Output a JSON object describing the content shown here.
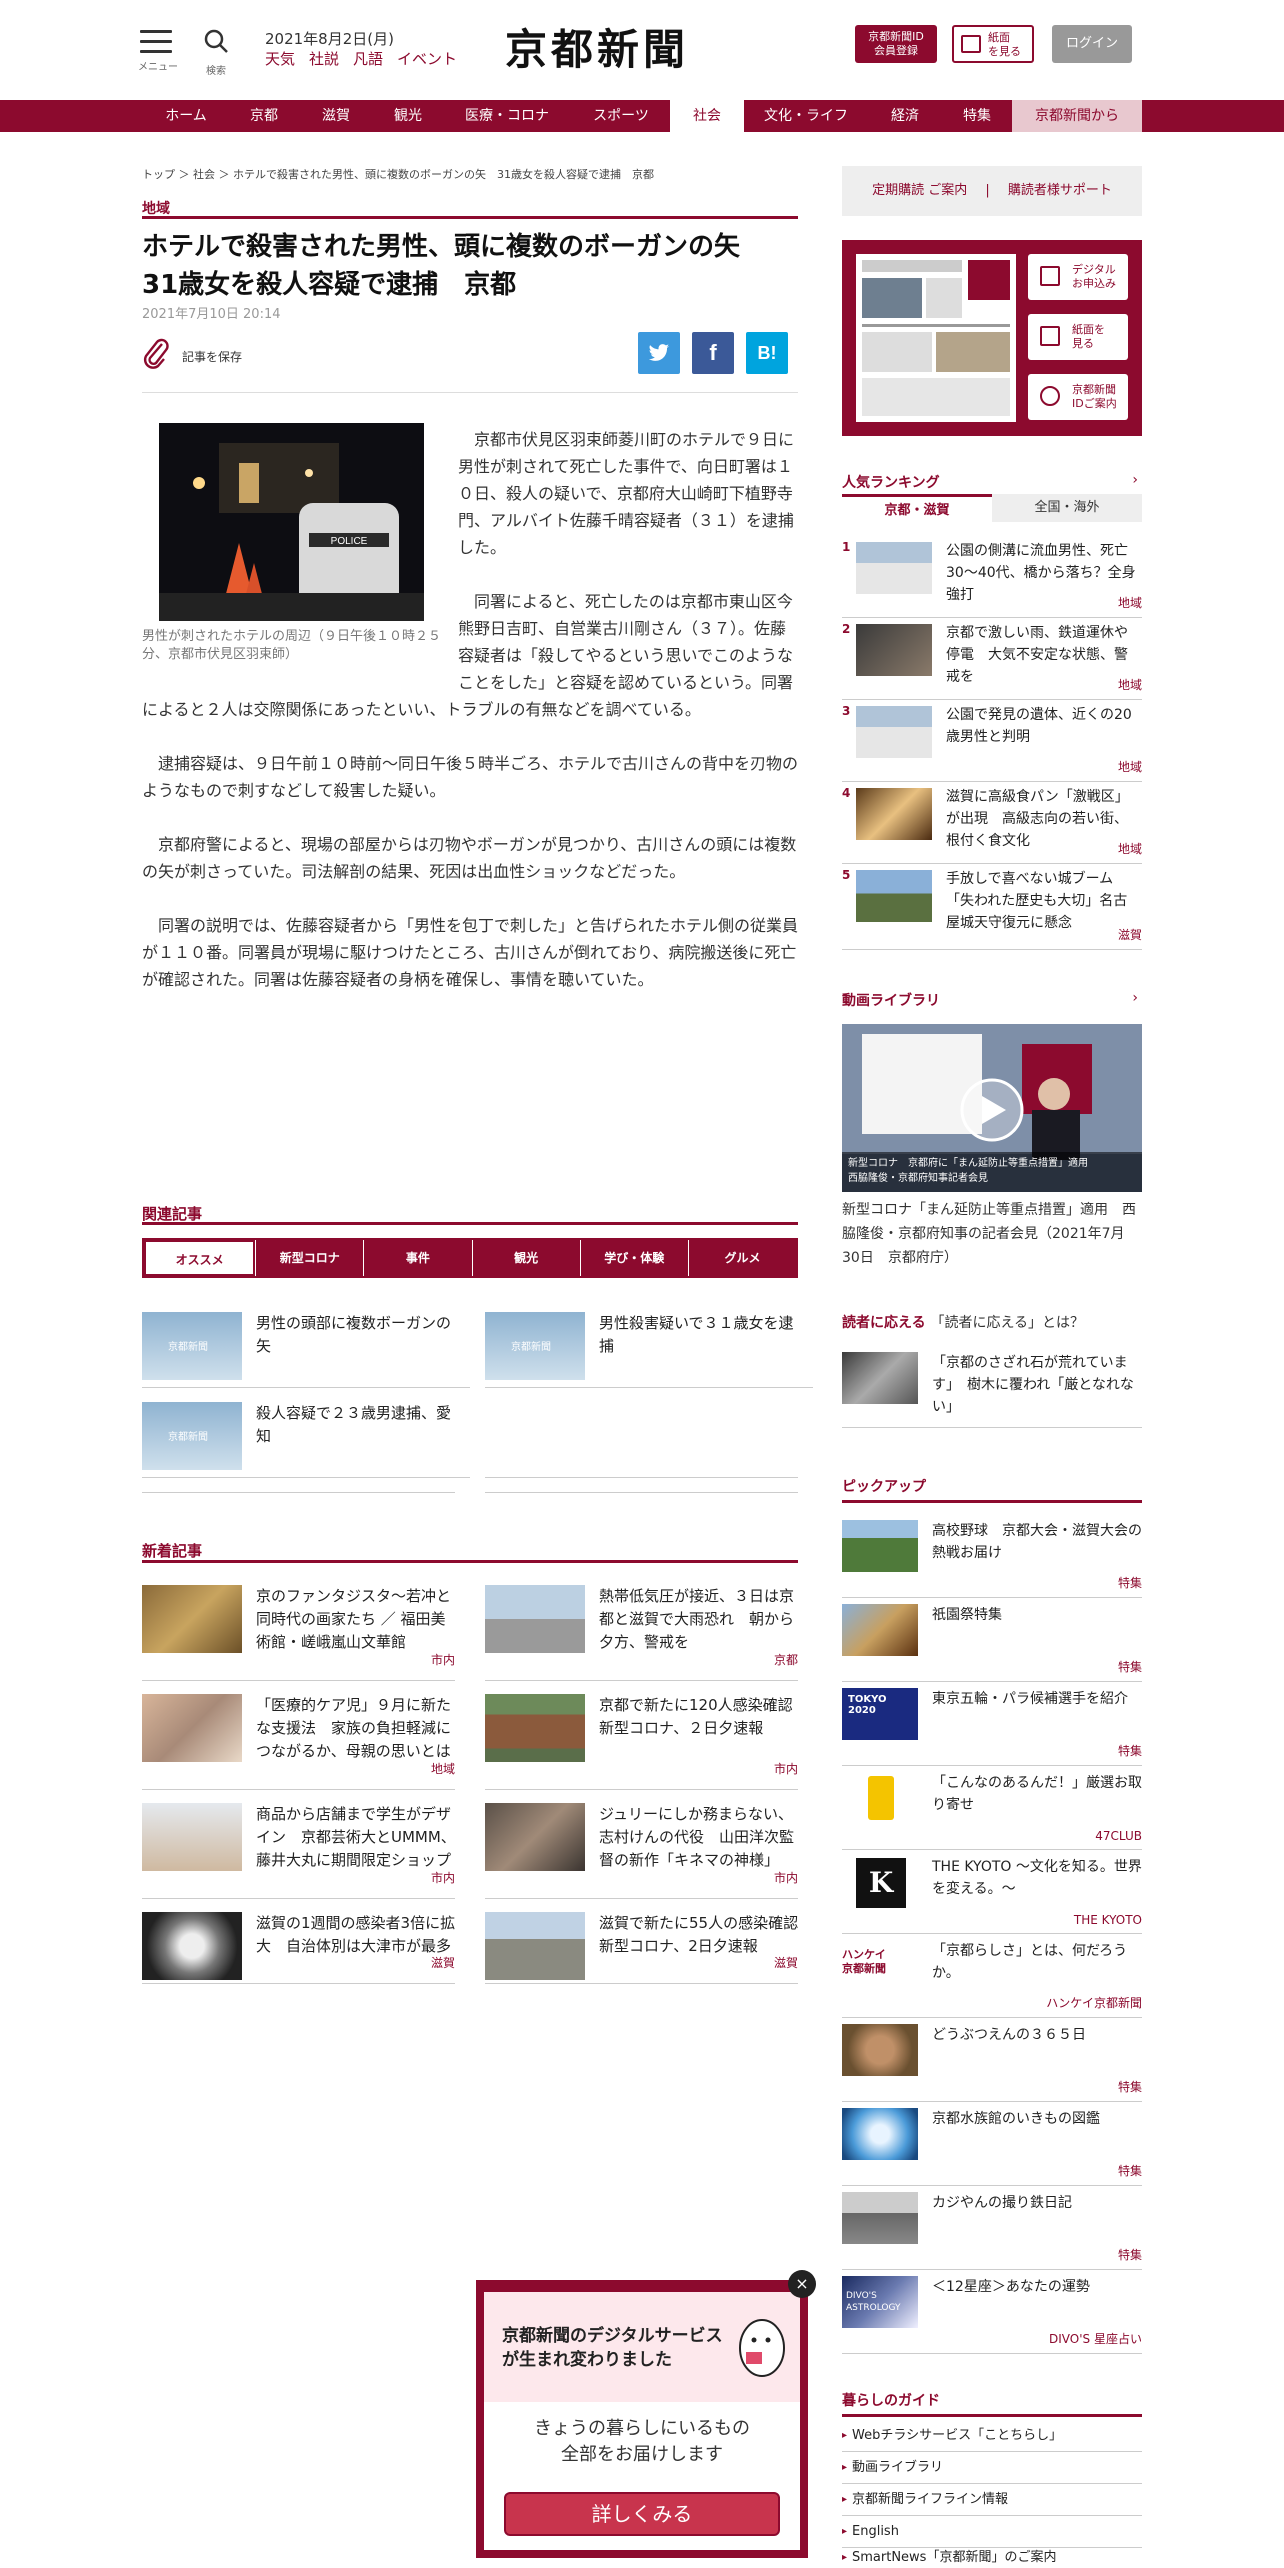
{
  "header": {
    "menu_label": "メニュー",
    "search_label": "検索",
    "date": "2021年8月2日(月)",
    "links": [
      "天気",
      "社説",
      "凡語",
      "イベント"
    ],
    "logo": "京都新聞",
    "member_button": "京都新聞ID\n会員登録",
    "paper_button": "紙面\nを見る",
    "login_button": "ログイン"
  },
  "nav": [
    "ホーム",
    "京都",
    "滋賀",
    "観光",
    "医療・コロナ",
    "スポーツ",
    "社会",
    "文化・ライフ",
    "経済",
    "特集",
    "京都新聞から"
  ],
  "nav_active": "社会",
  "article": {
    "breadcrumb": "トップ ＞ 社会 ＞ ホテルで殺害された男性、頭に複数のボーガンの矢　31歳女を殺人容疑で逮捕　京都",
    "category": "地域",
    "title": "ホテルで殺害された男性、頭に複数のボーガンの矢　31歳女を殺人容疑で逮捕　京都",
    "date": "2021年7月10日 20:14",
    "save_label": "記事を保存",
    "photo_caption": "男性が刺されたホテルの周辺（９日午後１０時２５分、京都市伏見区羽束師）",
    "paragraphs": [
      "京都市伏見区羽束師菱川町のホテルで９日に男性が刺されて死亡した事件で、向日町署は１０日、殺人の疑いで、京都府大山崎町下植野寺門、アルバイト佐藤千晴容疑者（３１）を逮捕した。",
      "同署によると、死亡したのは京都市東山区今熊野日吉町、自営業古川剛さん（３７）。佐藤容疑者は「殺してやるという思いでこのようなことをした」と容疑を認めているという。同署によると２人は交際関係にあったといい、トラブルの有無などを調べている。",
      "逮捕容疑は、９日午前１０時前～同日午後５時半ごろ、ホテルで古川さんの背中を刃物のようなもので刺すなどして殺害した疑い。",
      "京都府警によると、現場の部屋からは刃物やボーガンが見つかり、古川さんの頭には複数の矢が刺さっていた。司法解剖の結果、死因は出血性ショックなどだった。",
      "同署の説明では、佐藤容疑者から「男性を包丁で刺した」と告げられたホテル側の従業員が１１０番。同署員が現場に駆けつけたところ、古川さんが倒れており、病院搬送後に死亡が確認された。同署は佐藤容疑者の身柄を確保し、事情を聴いていた。"
    ]
  },
  "related": {
    "heading": "関連記事",
    "tabs": [
      "オススメ",
      "新型コロナ",
      "事件",
      "観光",
      "学び・体験",
      "グルメ"
    ],
    "thumb_label": "京都新聞",
    "items": [
      {
        "title": "男性の頭部に複数ボーガンの矢"
      },
      {
        "title": "男性殺害疑いで３１歳女を逮捕"
      },
      {
        "title": "殺人容疑で２３歳男逮捕、愛知"
      }
    ]
  },
  "latest": {
    "heading": "新着記事",
    "items": [
      {
        "title": "京のファンタジスタ～若冲と同時代の画家たち ／ 福田美術館・嵯峨嵐山文華館",
        "tag": "市内"
      },
      {
        "title": "熱帯低気圧が接近、３日は京都と滋賀で大雨恐れ　朝から夕方、警戒を",
        "tag": "京都"
      },
      {
        "title": "「医療的ケア児」９月に新たな支援法　家族の負担軽減につながるか、母親の思いとは",
        "tag": "地域"
      },
      {
        "title": "京都で新たに120人感染確認　新型コロナ、２日夕速報",
        "tag": "市内"
      },
      {
        "title": "商品から店舗まで学生がデザイン　京都芸術大とUMMM、藤井大丸に期間限定ショップ",
        "tag": "市内"
      },
      {
        "title": "ジュリーにしか務まらない、志村けんの代役　山田洋次監督の新作「キネマの神様」",
        "tag": "市内"
      },
      {
        "title": "滋賀の1週間の感染者3倍に拡大　自治体別は大津市が最多",
        "tag": "滋賀"
      },
      {
        "title": "滋賀で新たに55人の感染確認　新型コロナ、2日夕速報",
        "tag": "滋賀"
      }
    ]
  },
  "sidebar": {
    "subscription_links": [
      "定期購読 ご案内",
      "購読者様サポート"
    ],
    "paper_buttons": [
      "デジタル\nお申込み",
      "紙面を\n見る",
      "京都新聞\nIDご案内"
    ],
    "ranking": {
      "heading": "人気ランキング",
      "tabs": [
        "京都・滋賀",
        "全国・海外"
      ],
      "items": [
        {
          "num": "1",
          "title": "公園の側溝に流血男性、死亡　30～40代、橋から落ち？全身強打",
          "tag": "地域"
        },
        {
          "num": "2",
          "title": "京都で激しい雨、鉄道運休や停電　大気不安定な状態、警戒を",
          "tag": "地域"
        },
        {
          "num": "3",
          "title": "公園で発見の遺体、近くの20歳男性と判明",
          "tag": "地域"
        },
        {
          "num": "4",
          "title": "滋賀に高級食パン「激戦区」が出現　高級志向の若い街、根付く食文化",
          "tag": "地域"
        },
        {
          "num": "5",
          "title": "手放しで喜べない城ブーム「失われた歴史も大切」名古屋城天守復元に懸念",
          "tag": "滋賀"
        }
      ]
    },
    "video": {
      "heading": "動画ライブラリ",
      "overlay": "新型コロナ　京都府に「まん延防止等重点措置」適用\n西脇隆俊・京都府知事記者会見",
      "title": "新型コロナ「まん延防止等重点措置」適用　西脇隆俊・京都府知事の記者会見（2021年7月30日　京都府庁）"
    },
    "reader": {
      "heading": "読者に応える",
      "sub": "「読者に応える」とは？",
      "item": "「京都のさざれ石が荒れています」　樹木に覆われ「厳となれない」"
    },
    "pickup": {
      "heading": "ピックアップ",
      "items": [
        {
          "title": "高校野球　京都大会・滋賀大会の熱戦お届け",
          "tag": "特集"
        },
        {
          "title": "祇園祭特集",
          "tag": "特集"
        },
        {
          "title": "東京五輪・パラ候補選手を紹介",
          "tag": "特集"
        },
        {
          "title": "「こんなのあるんだ！」厳選お取り寄せ",
          "tag": "47CLUB"
        },
        {
          "title": "THE KYOTO ～文化を知る。世界を変える。～",
          "tag": "THE KYOTO"
        },
        {
          "title": "「京都らしさ」とは、何だろうか。",
          "tag": "ハンケイ京都新聞"
        },
        {
          "title": "どうぶつえんの３６５日",
          "tag": "特集"
        },
        {
          "title": "京都水族館のいきもの図鑑",
          "tag": "特集"
        },
        {
          "title": "カジやんの撮り鉄日記",
          "tag": "特集"
        },
        {
          "title": "＜12星座＞あなたの運勢",
          "tag": "DIVO'S 星座占い"
        }
      ],
      "tokyo_badge": "TOKYO\n2020",
      "k_badge": "K",
      "hankei_badge": "ハンケイ\n京都新聞",
      "divo_badge": "DIVO'S\nASTROLOGY"
    },
    "guide": {
      "heading": "暮らしのガイド",
      "items": [
        "Webチラシサービス「ことちらし」",
        "動画ライブラリ",
        "京都新聞ライフライン情報",
        "English",
        "SmartNews「京都新聞」のご案内"
      ]
    }
  },
  "popup": {
    "heading": "京都新聞のデジタルサービスが生まれ変わりました",
    "body": "きょうの暮らしにいるもの\n全部をお届けします",
    "button": "詳しくみる",
    "close": "×"
  },
  "colors": {
    "brand": "#8c0a2e",
    "twitter": "#3d99dd",
    "facebook": "#3b5998",
    "hatena": "#00a4de"
  }
}
